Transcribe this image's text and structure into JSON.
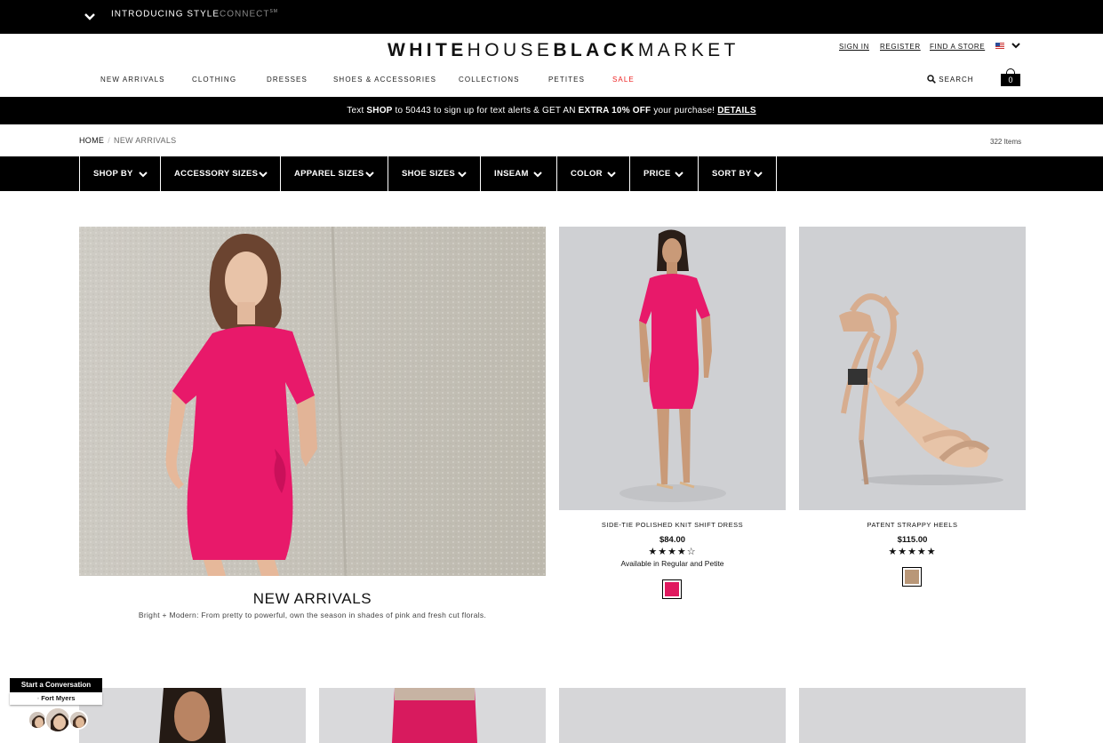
{
  "topbar": {
    "promo_bold": "INTRODUCING STYLE",
    "promo_thin": "CONNECT",
    "promo_sup": "SM"
  },
  "logo": {
    "part1": "WHITE",
    "part2": "HOUSE",
    "part3": "BLACK",
    "part4": "MARKET"
  },
  "account": {
    "sign_in": "SIGN IN",
    "register": "REGISTER",
    "find_store": "FIND A STORE"
  },
  "nav": [
    "NEW ARRIVALS",
    "CLOTHING",
    "DRESSES",
    "SHOES & ACCESSORIES",
    "COLLECTIONS",
    "PETITES",
    "SALE"
  ],
  "search": {
    "label": "SEARCH"
  },
  "bag": {
    "count": "0"
  },
  "promo": {
    "t1": "Text ",
    "t2": "SHOP",
    "t3": " to 50443 to sign up for text alerts & GET AN ",
    "t4": "EXTRA 10% OFF",
    "t5": " your purchase! ",
    "link": "DETAILS"
  },
  "breadcrumb": {
    "home": "HOME",
    "sep": "/",
    "current": "NEW ARRIVALS"
  },
  "item_count": "322 Items",
  "filters": [
    "SHOP BY",
    "ACCESSORY SIZES",
    "APPAREL SIZES",
    "SHOE SIZES",
    "INSEAM",
    "COLOR",
    "PRICE",
    "SORT BY"
  ],
  "hero": {
    "title": "NEW ARRIVALS",
    "subtitle": "Bright + Modern: From pretty to powerful, own the season in shades of pink and fresh cut florals."
  },
  "products": [
    {
      "name": "SIDE-TIE POLISHED KNIT SHIFT DRESS",
      "price": "$84.00",
      "rating": 4,
      "stars": "★★★★☆",
      "availability": "Available in Regular and Petite",
      "swatch": "#e0195f"
    },
    {
      "name": "PATENT STRAPPY HEELS",
      "price": "$115.00",
      "rating": 5,
      "stars": "★★★★★",
      "availability": "",
      "swatch": "#b99778"
    }
  ],
  "chat": {
    "title": "Start a Conversation",
    "location": "Fort Myers"
  },
  "colors": {
    "black": "#000000",
    "sale": "#ee2222",
    "dress_pink": "#e8196a"
  }
}
